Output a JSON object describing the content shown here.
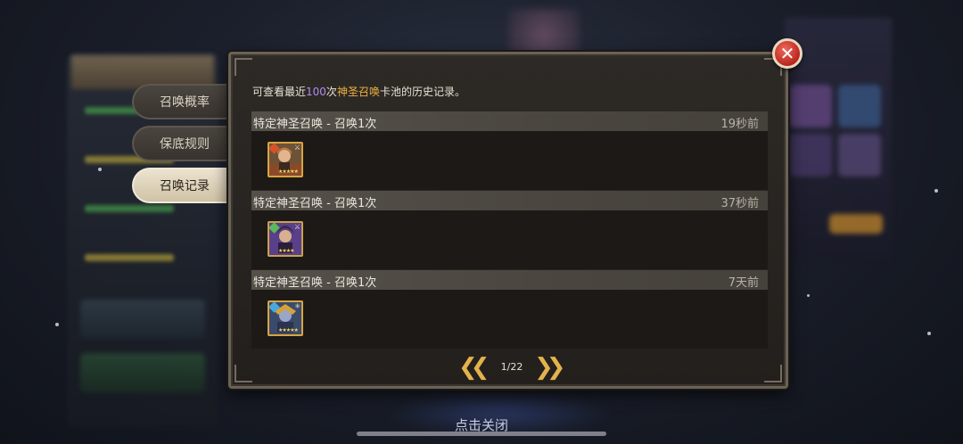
{
  "tabs": [
    {
      "label": "召唤概率",
      "active": false
    },
    {
      "label": "保底规则",
      "active": false
    },
    {
      "label": "召唤记录",
      "active": true
    }
  ],
  "description": {
    "prefix": "可查看最近",
    "count": "100",
    "middle": "次",
    "pool_name": "神圣召唤",
    "suffix": "卡池的历史记录。"
  },
  "records": [
    {
      "title": "特定神圣召唤 - 召唤1次",
      "time": "19秒前",
      "hero": {
        "stars": "★★★★★",
        "element": "fire",
        "class_icon": "dagger-icon"
      }
    },
    {
      "title": "特定神圣召唤 - 召唤1次",
      "time": "37秒前",
      "hero": {
        "stars": "★★★★",
        "element": "earth",
        "class_icon": "dagger-icon"
      }
    },
    {
      "title": "特定神圣召唤 - 召唤1次",
      "time": "7天前",
      "hero": {
        "stars": "★★★★★",
        "element": "ice",
        "class_icon": "star-icon"
      }
    }
  ],
  "pager": {
    "current": "1/22",
    "prev_symbol": "❮❮",
    "next_symbol": "❯❯"
  },
  "close_symbol": "✕",
  "tap_to_close": "点击关闭",
  "colors": {
    "accent_gold": "#f0b040",
    "accent_purple": "#b08cf0",
    "close_red": "#c8312a"
  }
}
